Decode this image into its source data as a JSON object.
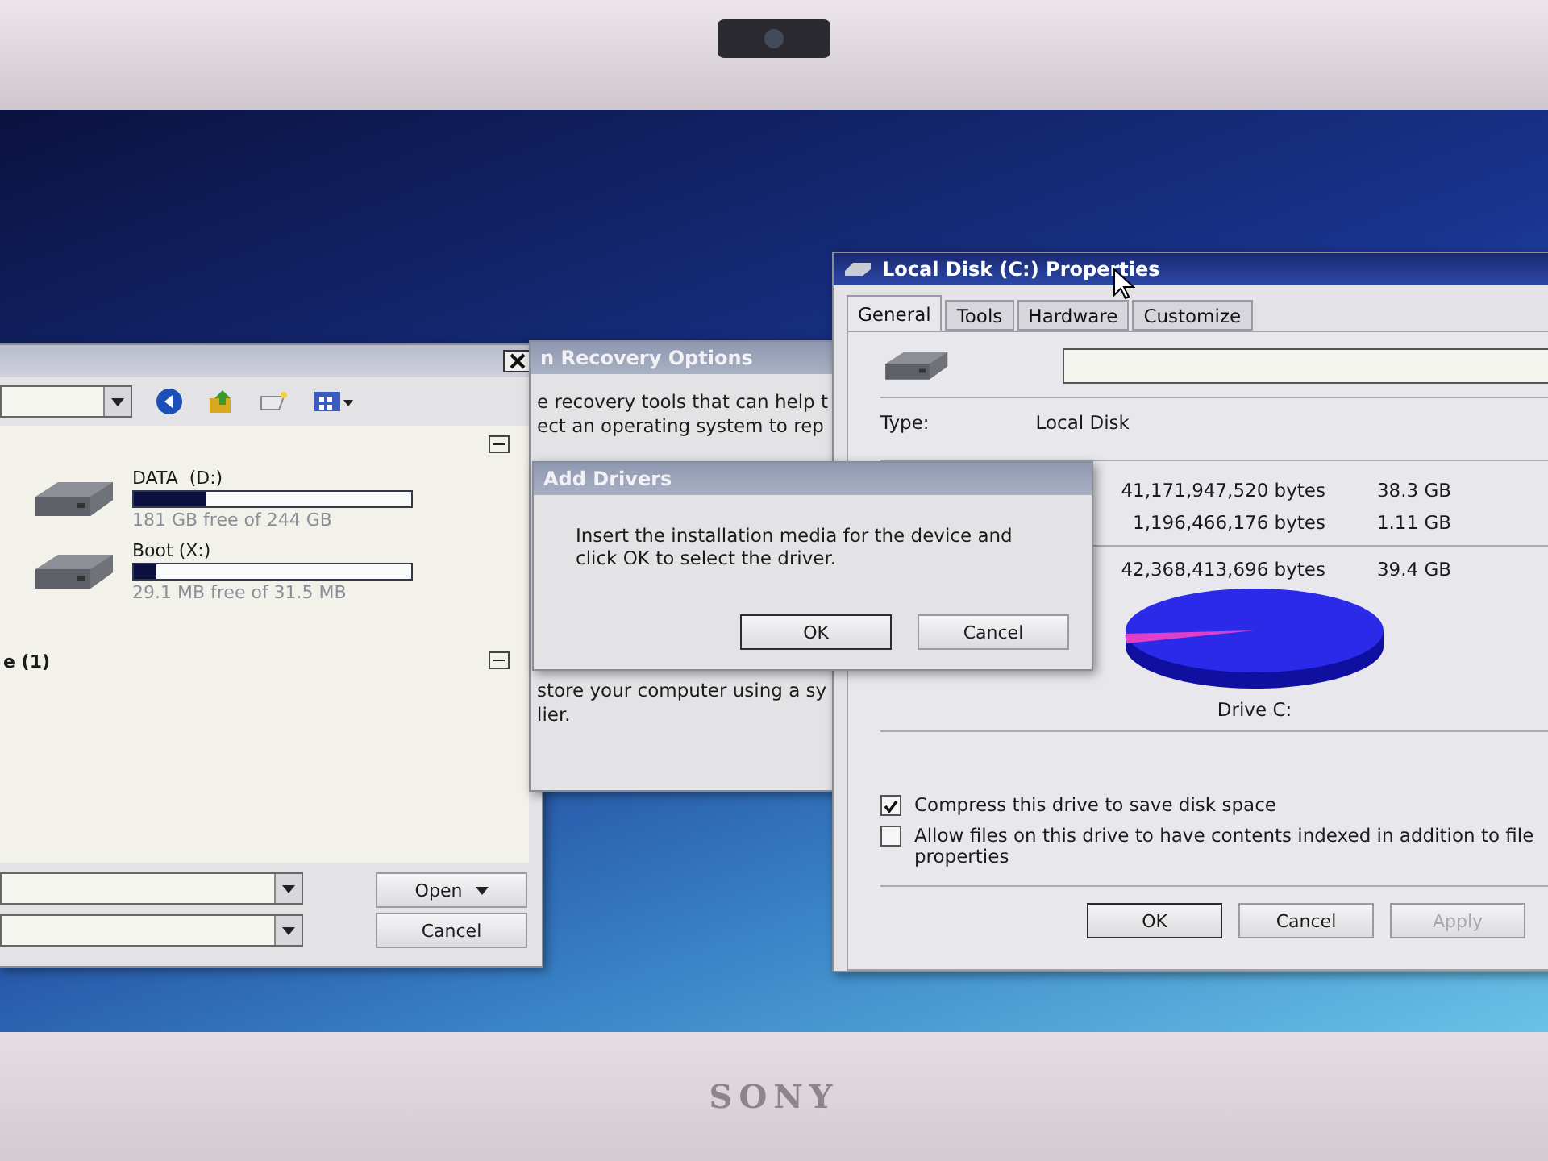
{
  "bezel": {
    "logo": "SONY"
  },
  "file_dialog": {
    "drives": [
      {
        "name": "DATA  (D:)",
        "level": 0.26,
        "free": "181 GB free of 244 GB"
      },
      {
        "name": "Boot (X:)",
        "level": 0.08,
        "free": "29.1 MB free of 31.5 MB"
      }
    ],
    "group_label": "e (1)",
    "buttons": [
      {
        "label": "Open",
        "kind": "split"
      },
      {
        "label": "Cancel",
        "kind": "plain"
      }
    ]
  },
  "recovery_window": {
    "title": "n Recovery Options",
    "lines": [
      "e recovery tools that can help t",
      "ect an operating system to rep"
    ],
    "lines_below": [
      "store your computer using a sy",
      "lier."
    ]
  },
  "add_drivers": {
    "title": "Add Drivers",
    "message": "Insert the installation media for the device and click OK to select the driver.",
    "buttons": [
      {
        "label": "OK",
        "default": true
      },
      {
        "label": "Cancel",
        "default": false
      }
    ]
  },
  "properties": {
    "title": "Local Disk (C:) Properties",
    "tabs": [
      {
        "label": "General",
        "selected": true
      },
      {
        "label": "Tools",
        "selected": false
      },
      {
        "label": "Hardware",
        "selected": false
      },
      {
        "label": "Customize",
        "selected": false
      }
    ],
    "type_label": "Type:",
    "type_value": "Local Disk",
    "sizes": [
      {
        "bytes": "41,171,947,520 bytes",
        "size": "38.3 GB"
      },
      {
        "bytes": "1,196,466,176 bytes",
        "size": "1.11 GB"
      },
      {
        "bytes": "42,368,413,696 bytes",
        "size": "39.4 GB"
      }
    ],
    "drive_label": "Drive C:",
    "options": [
      {
        "label": "Compress this drive to save disk space",
        "checked": true
      },
      {
        "label": "Allow files on this drive to have contents indexed in addition to file properties",
        "checked": false
      }
    ],
    "buttons": [
      {
        "label": "OK",
        "disabled": false
      },
      {
        "label": "Cancel",
        "disabled": false
      },
      {
        "label": "Apply",
        "disabled": true
      }
    ]
  }
}
